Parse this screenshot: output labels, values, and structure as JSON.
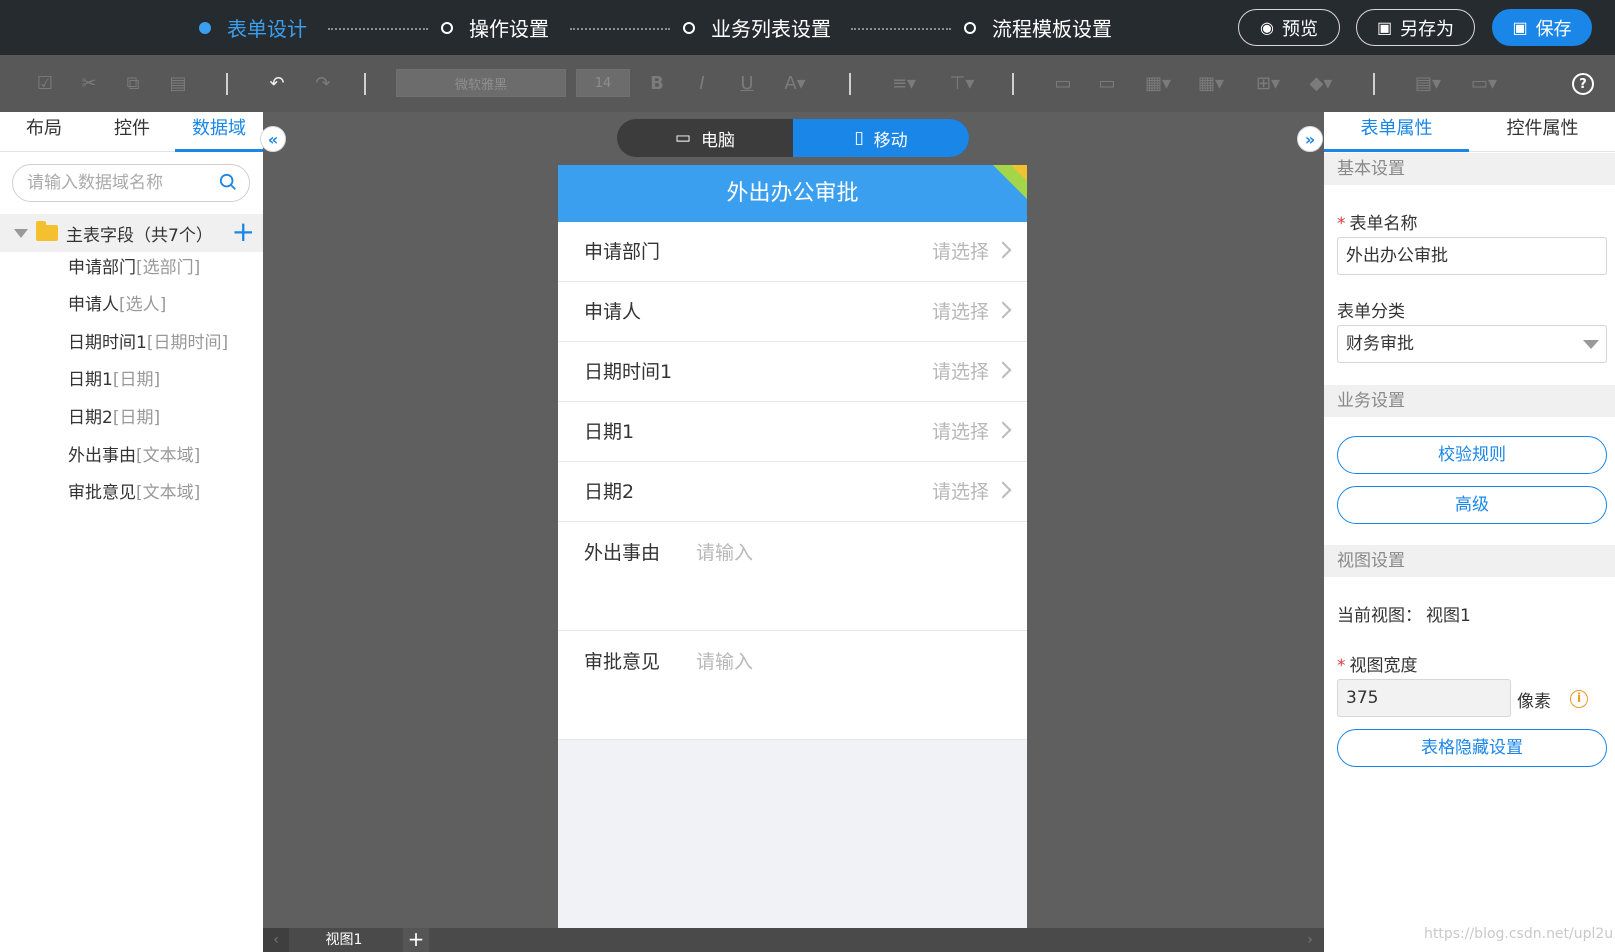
{
  "steps": [
    {
      "label": "表单设计",
      "active": true
    },
    {
      "label": "操作设置",
      "active": false
    },
    {
      "label": "业务列表设置",
      "active": false
    },
    {
      "label": "流程模板设置",
      "active": false
    }
  ],
  "top_buttons": {
    "preview": "预览",
    "save_as": "另存为",
    "save": "保存"
  },
  "toolbar": {
    "font_family": "微软雅黑",
    "font_size": "14"
  },
  "left_panel": {
    "tabs": [
      "布局",
      "控件",
      "数据域"
    ],
    "active_tab": "数据域",
    "search_placeholder": "请输入数据域名称",
    "root": "主表字段（共7个）",
    "fields": [
      {
        "name": "申请部门",
        "type": "[选部门]"
      },
      {
        "name": "申请人",
        "type": "[选人]"
      },
      {
        "name": "日期时间1",
        "type": "[日期时间]"
      },
      {
        "name": "日期1",
        "type": "[日期]"
      },
      {
        "name": "日期2",
        "type": "[日期]"
      },
      {
        "name": "外出事由",
        "type": "[文本域]"
      },
      {
        "name": "审批意见",
        "type": "[文本域]"
      }
    ]
  },
  "device_toggle": {
    "pc": "电脑",
    "mobile": "移动",
    "active": "mobile"
  },
  "form": {
    "title": "外出办公审批",
    "select_rows": [
      {
        "label": "申请部门",
        "placeholder": "请选择"
      },
      {
        "label": "申请人",
        "placeholder": "请选择"
      },
      {
        "label": "日期时间1",
        "placeholder": "请选择"
      },
      {
        "label": "日期1",
        "placeholder": "请选择"
      },
      {
        "label": "日期2",
        "placeholder": "请选择"
      }
    ],
    "text_rows": [
      {
        "label": "外出事由",
        "placeholder": "请输入"
      },
      {
        "label": "审批意见",
        "placeholder": "请输入"
      }
    ]
  },
  "bottom_bar": {
    "tab": "视图1",
    "add": "+"
  },
  "right_panel": {
    "tabs": [
      "表单属性",
      "控件属性"
    ],
    "active_tab": "表单属性",
    "basic_section": "基本设置",
    "form_name_label": "表单名称",
    "form_name_value": "外出办公审批",
    "form_category_label": "表单分类",
    "form_category_value": "财务审批",
    "business_section": "业务设置",
    "validate_btn": "校验规则",
    "advanced_btn": "高级",
    "view_section": "视图设置",
    "current_view_label": "当前视图：",
    "current_view_value": "视图1",
    "view_width_label": "视图宽度",
    "view_width_value": "375",
    "view_width_unit": "像素",
    "table_hide_btn": "表格隐藏设置"
  },
  "watermark": "https://blog.csdn.net/upl2u",
  "colors": {
    "accent": "#1a86e8",
    "header": "#3a9fef",
    "topbar": "#262b30"
  }
}
